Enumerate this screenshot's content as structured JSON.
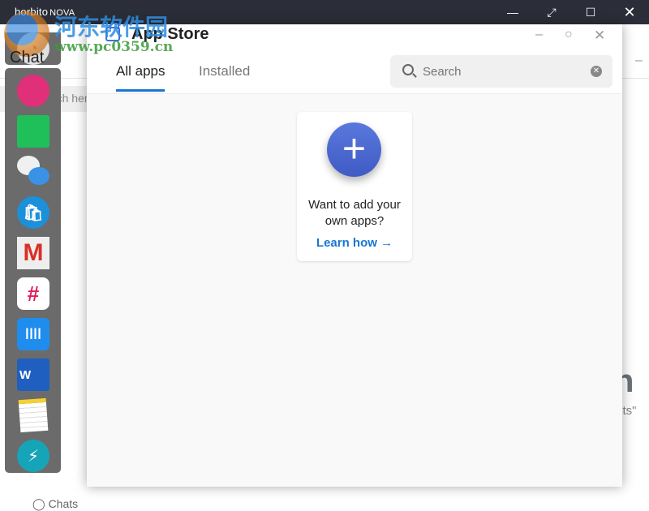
{
  "window": {
    "brand": "horbito",
    "brand_suffix": "NOVA",
    "controls": [
      "minimize",
      "fullscreen",
      "maximize",
      "close"
    ]
  },
  "background_app": {
    "title": "Chat",
    "search_placeholder": "Search here",
    "bottom_tab": "Chats",
    "partial_heading": "n",
    "partial_text": "cts\""
  },
  "app_store": {
    "title": "App Store",
    "tabs": [
      {
        "label": "All apps",
        "active": true
      },
      {
        "label": "Installed",
        "active": false
      }
    ],
    "search": {
      "placeholder": "Search",
      "value": ""
    },
    "card": {
      "text": "Want to add your own apps?",
      "link": "Learn how →"
    }
  },
  "dock": {
    "apps": [
      "chat",
      "planet",
      "files",
      "messages",
      "store",
      "gmail",
      "slack",
      "intercom",
      "word",
      "notes",
      "lightning"
    ]
  },
  "colors": {
    "accent": "#1976d2",
    "titlebar": "#2b2e38",
    "dock": "#6b6b6b",
    "plus_button": "#4a68d0"
  },
  "watermark": {
    "text": "河东软件园",
    "url": "www.pc0359.cn"
  }
}
